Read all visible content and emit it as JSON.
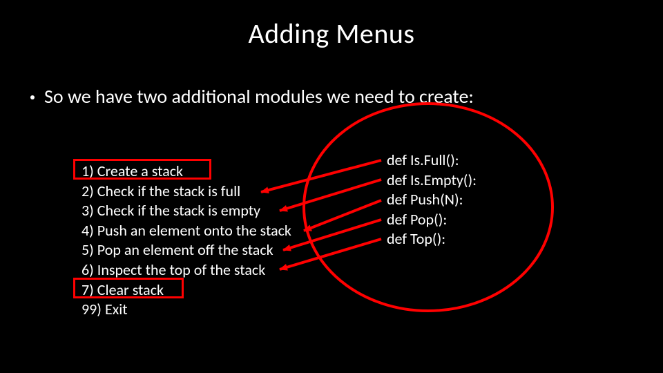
{
  "title": "Adding Menus",
  "bullet": "So we have two additional modules we need to create:",
  "menu": {
    "item1": "1) Create a stack",
    "item2": "2) Check if the stack is full",
    "item3": "3) Check if the stack is empty",
    "item4": "4) Push an element onto the stack",
    "item5": "5) Pop an element off the stack",
    "item6": "6) Inspect the top of the stack",
    "item7": "7) Clear stack",
    "item99": "99) Exit"
  },
  "defs": {
    "d1": "def Is.Full():",
    "d2": "def Is.Empty():",
    "d3": "def Push(N):",
    "d4": "def Pop():",
    "d5": "def Top():"
  },
  "annotation_color": "#ff0000"
}
